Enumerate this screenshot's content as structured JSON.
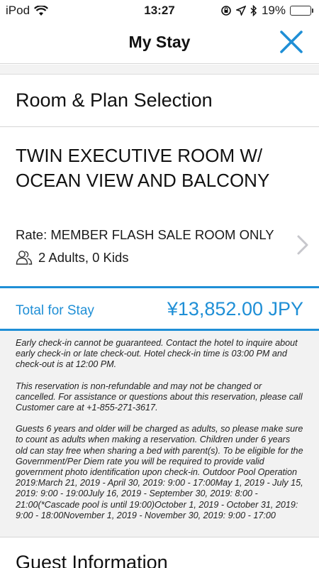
{
  "status_bar": {
    "carrier": "iPod",
    "time": "13:27",
    "battery_percent": "19%",
    "battery_level": 0.19,
    "icons": [
      "wifi-icon",
      "orientation-lock-icon",
      "location-icon",
      "bluetooth-icon",
      "battery-icon"
    ]
  },
  "nav": {
    "title": "My Stay",
    "close_icon": "close-icon",
    "accent": "#1f8fd6"
  },
  "room_plan": {
    "header": "Room & Plan Selection",
    "room_name": "TWIN EXECUTIVE ROOM W/ OCEAN VIEW AND BALCONY",
    "rate": "Rate: MEMBER FLASH SALE ROOM ONLY",
    "guests": "2 Adults, 0 Kids",
    "guests_icon": "people-icon",
    "chevron_icon": "chevron-right-icon"
  },
  "total": {
    "label": "Total for Stay",
    "value": "¥13,852.00 JPY"
  },
  "policy": {
    "paragraphs": [
      "Early check-in cannot be guaranteed. Contact the hotel to inquire about early check-in or late check-out. Hotel check-in time is 03:00 PM and check-out is at 12:00 PM.",
      "This reservation is non-refundable and may not be changed or cancelled. For assistance or questions about this reservation, please call Customer care at +1-855-271-3617.",
      "Guests 6 years and older will be charged as adults, so please make sure to count as adults when making a reservation. Children under 6 years old can stay free when sharing a bed with parent(s). To be eligible for the Government/Per Diem rate you will be required to provide valid government photo identification upon check-in. Outdoor Pool Operation 2019:March 21, 2019 - April 30, 2019: 9:00 - 17:00May 1, 2019 - July 15, 2019: 9:00 - 19:00July 16, 2019 - September 30, 2019: 8:00 - 21:00(*Cascade pool is until 19:00)October 1, 2019 - October 31, 2019: 9:00 - 18:00November 1, 2019 - November 30, 2019: 9:00 - 17:00"
    ]
  },
  "guest_info": {
    "header": "Guest Information"
  }
}
